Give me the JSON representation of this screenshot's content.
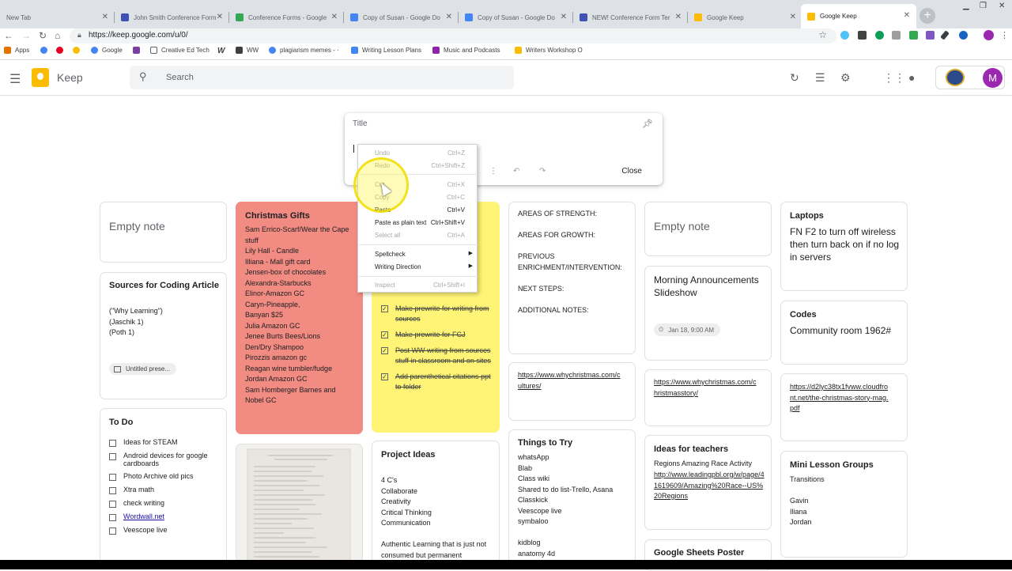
{
  "browser": {
    "tabs": [
      {
        "title": "New Tab",
        "favicon_color": "#dadce0"
      },
      {
        "title": "John Smith Conference Form",
        "favicon_color": "#3f51b5"
      },
      {
        "title": "Conference Forms - Google",
        "favicon_color": "#34a853"
      },
      {
        "title": "Copy of Susan - Google Do",
        "favicon_color": "#4285f4"
      },
      {
        "title": "Copy of Susan - Google Do",
        "favicon_color": "#4285f4"
      },
      {
        "title": "NEW! Conference Form Ter",
        "favicon_color": "#3f51b5"
      },
      {
        "title": "Google Keep",
        "favicon_color": "#fbbc04"
      },
      {
        "title": "Google Keep",
        "favicon_color": "#fbbc04"
      }
    ],
    "url": "https://keep.google.com/u/0/",
    "bookmarks": [
      {
        "label": "Apps",
        "color": "#e37400"
      },
      {
        "label": "",
        "color": "#4285f4"
      },
      {
        "label": "",
        "color": "#e60023"
      },
      {
        "label": "",
        "color": "#fbbc04"
      },
      {
        "label": "Google",
        "color": "#4285f4"
      },
      {
        "label": "",
        "color": "#7b3fa0"
      },
      {
        "label": "Creative Ed Tech",
        "color": "#ffffff"
      },
      {
        "label": "",
        "color": "#202124"
      },
      {
        "label": "WW",
        "color": "#3c4043"
      },
      {
        "label": "plagiarism memes - ·",
        "color": "#4285f4"
      },
      {
        "label": "Writing Lesson Plans",
        "color": "#4285f4"
      },
      {
        "label": "Music and Podcasts",
        "color": "#8e24aa"
      },
      {
        "label": "Writers Workshop O",
        "color": "#fbbc04"
      }
    ]
  },
  "keep": {
    "app_name": "Keep",
    "search_placeholder": "Search",
    "avatar_letter": "M",
    "composer": {
      "title_placeholder": "Title",
      "close_label": "Close"
    },
    "context_menu": [
      {
        "label": "Undo",
        "shortcut": "Ctrl+Z",
        "disabled": true
      },
      {
        "label": "Redo",
        "shortcut": "Ctrl+Shift+Z",
        "disabled": true
      },
      {
        "label": "Cut",
        "shortcut": "Ctrl+X",
        "disabled": true
      },
      {
        "label": "Copy",
        "shortcut": "Ctrl+C",
        "disabled": true
      },
      {
        "label": "Paste",
        "shortcut": "Ctrl+V",
        "disabled": false
      },
      {
        "label": "Paste as plain text",
        "shortcut": "Ctrl+Shift+V",
        "disabled": false
      },
      {
        "label": "Select all",
        "shortcut": "Ctrl+A",
        "disabled": true
      },
      {
        "label": "Spellcheck",
        "shortcut": "",
        "disabled": false
      },
      {
        "label": "Writing Direction",
        "shortcut": "",
        "disabled": false
      },
      {
        "label": "Inspect",
        "shortcut": "Ctrl+Shift+I",
        "disabled": true
      }
    ],
    "notes": {
      "empty_note_label": "Empty note",
      "coding": {
        "title": "Sources for Coding Article",
        "body": "(\"Why Learning\")\n(Jaschik 1)\n(Poth 1)",
        "chip": "Untitled prese..."
      },
      "todo": {
        "title": "To Do",
        "items": [
          "Ideas for STEAM",
          "Android devices for google cardboards",
          "Photo Archive old pics",
          "Xtra math",
          "check writing",
          "Wordwall.net",
          "Veescope live"
        ]
      },
      "christmas": {
        "title": "Christmas Gifts",
        "body": "Sam Errico-Scarf/Wear the Cape stuff\nLily Hall - Candle\nIlliana - Mall gift card\nJensen-box of chocolates\nAlexandra-Starbucks\nElinor-Amazon GC\nCaryn-Pineapple,\nBanyan $25\nJulia Amazon GC\nJenee Burts Bees/Lions\nDen/Dry Shampoo\nPirozzis amazon gc\nReagan wine tumbler/fudge\nJordan Amazon GC\nSam Homberger Barnes and Nobel GC"
      },
      "checklist": {
        "items": [
          "Make prewrite for writing from sources",
          "Make prewrite for FCJ",
          "Post WW writing from sources stuff in classroom and on sites",
          "Add parenthetical citations ppt to folder"
        ]
      },
      "project": {
        "title": "Project Ideas",
        "body": "4 C's\nCollaborate\nCreativity\nCritical Thinking\nCommunication",
        "body2": "Authentic Learning that is just not consumed but permanent"
      },
      "areas": {
        "body": "AREAS OF STRENGTH:\n\nAREAS FOR GROWTH:\n\nPREVIOUS ENRICHMENT/INTERVENTION:\n\nNEXT STEPS:\n\nADDITIONAL NOTES:"
      },
      "whychristmas1": {
        "link": "https://www.whychristmas.com/cultures/"
      },
      "things": {
        "title": "Things to Try",
        "body": "whatsApp\nBlab\nClass wiki\nShared to do list-Trello, Asana\nClasskick\nVeescope live\nsymbaloo\n\nkidblog\nanatomy 4d"
      },
      "morning": {
        "title": "Morning Announcements Slideshow",
        "reminder": "Jan 18, 9:00 AM"
      },
      "whychristmas2": {
        "link": "https://www.whychristmas.com/christmasstory/"
      },
      "ideas": {
        "title": "Ideas for teachers",
        "body": "Regions Amazing Race Activity",
        "link": "http://www.leadingpbl.org/w/page/41619609/Amazing%20Race--US%20Regions"
      },
      "sheets": {
        "title": "Google Sheets Poster"
      },
      "laptops": {
        "title": "Laptops",
        "body": "FN F2 to turn off wireless then turn back on if no log in servers"
      },
      "codes": {
        "title": "Codes",
        "body": "Community room 1962#"
      },
      "christmaslink": {
        "link": "https://d2lyc38tx1fvww.cloudfront.net/the-christmas-story-mag.pdf"
      },
      "minilesson": {
        "title": "Mini Lesson Groups",
        "body": "Transitions\n\nGavin\nIliana\nJordan"
      }
    }
  }
}
